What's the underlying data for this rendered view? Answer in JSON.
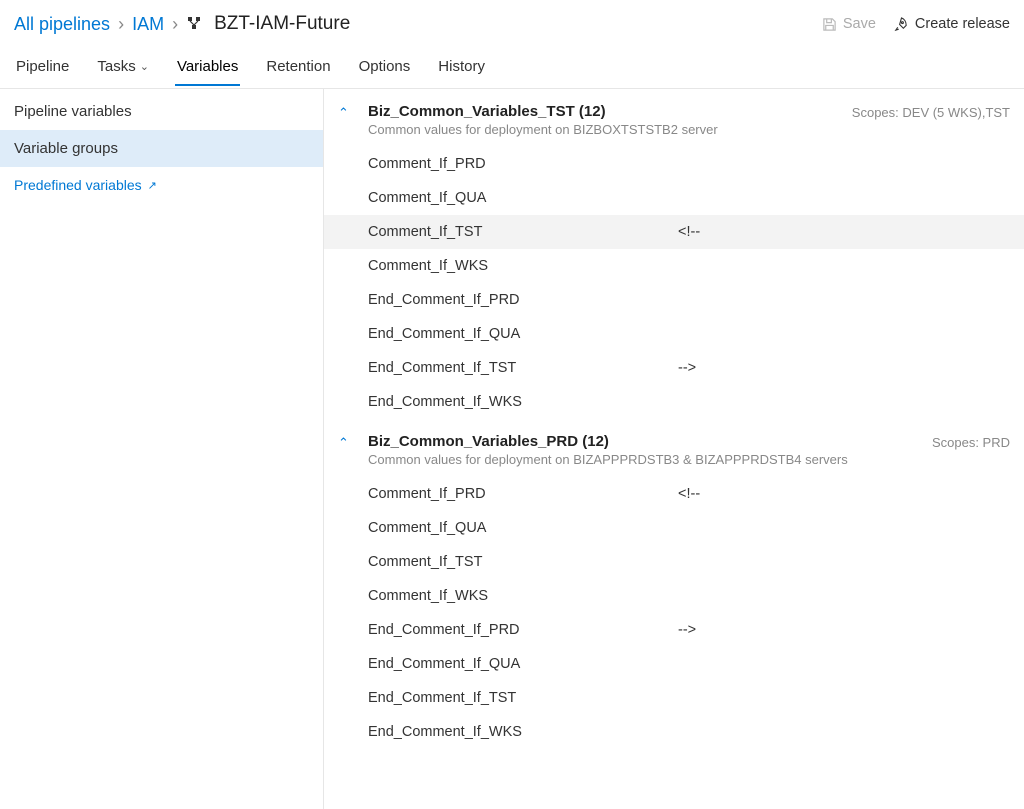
{
  "breadcrumb": {
    "all": "All pipelines",
    "folder": "IAM",
    "current": "BZT-IAM-Future"
  },
  "actions": {
    "save": "Save",
    "create_release": "Create release"
  },
  "tabs": [
    {
      "label": "Pipeline"
    },
    {
      "label": "Tasks"
    },
    {
      "label": "Variables"
    },
    {
      "label": "Retention"
    },
    {
      "label": "Options"
    },
    {
      "label": "History"
    }
  ],
  "left_panel": {
    "pipeline_vars": "Pipeline variables",
    "variable_groups": "Variable groups",
    "predefined": "Predefined variables"
  },
  "scopes_label": "Scopes:",
  "groups": [
    {
      "title": "Biz_Common_Variables_TST (12)",
      "desc": "Common values for deployment on BIZBOXTSTSTB2 server",
      "scope": "DEV (5 WKS),TST",
      "vars": [
        {
          "name": "Comment_If_PRD",
          "val": ""
        },
        {
          "name": "Comment_If_QUA",
          "val": ""
        },
        {
          "name": "Comment_If_TST",
          "val": "<!--",
          "hl": true
        },
        {
          "name": "Comment_If_WKS",
          "val": ""
        },
        {
          "name": "End_Comment_If_PRD",
          "val": ""
        },
        {
          "name": "End_Comment_If_QUA",
          "val": ""
        },
        {
          "name": "End_Comment_If_TST",
          "val": "-->"
        },
        {
          "name": "End_Comment_If_WKS",
          "val": ""
        }
      ]
    },
    {
      "title": "Biz_Common_Variables_PRD (12)",
      "desc": "Common values for deployment on BIZAPPPRDSTB3 & BIZAPPPRDSTB4 servers",
      "scope": "PRD",
      "vars": [
        {
          "name": "Comment_If_PRD",
          "val": "<!--"
        },
        {
          "name": "Comment_If_QUA",
          "val": ""
        },
        {
          "name": "Comment_If_TST",
          "val": ""
        },
        {
          "name": "Comment_If_WKS",
          "val": ""
        },
        {
          "name": "End_Comment_If_PRD",
          "val": "-->"
        },
        {
          "name": "End_Comment_If_QUA",
          "val": ""
        },
        {
          "name": "End_Comment_If_TST",
          "val": ""
        },
        {
          "name": "End_Comment_If_WKS",
          "val": ""
        }
      ]
    }
  ]
}
